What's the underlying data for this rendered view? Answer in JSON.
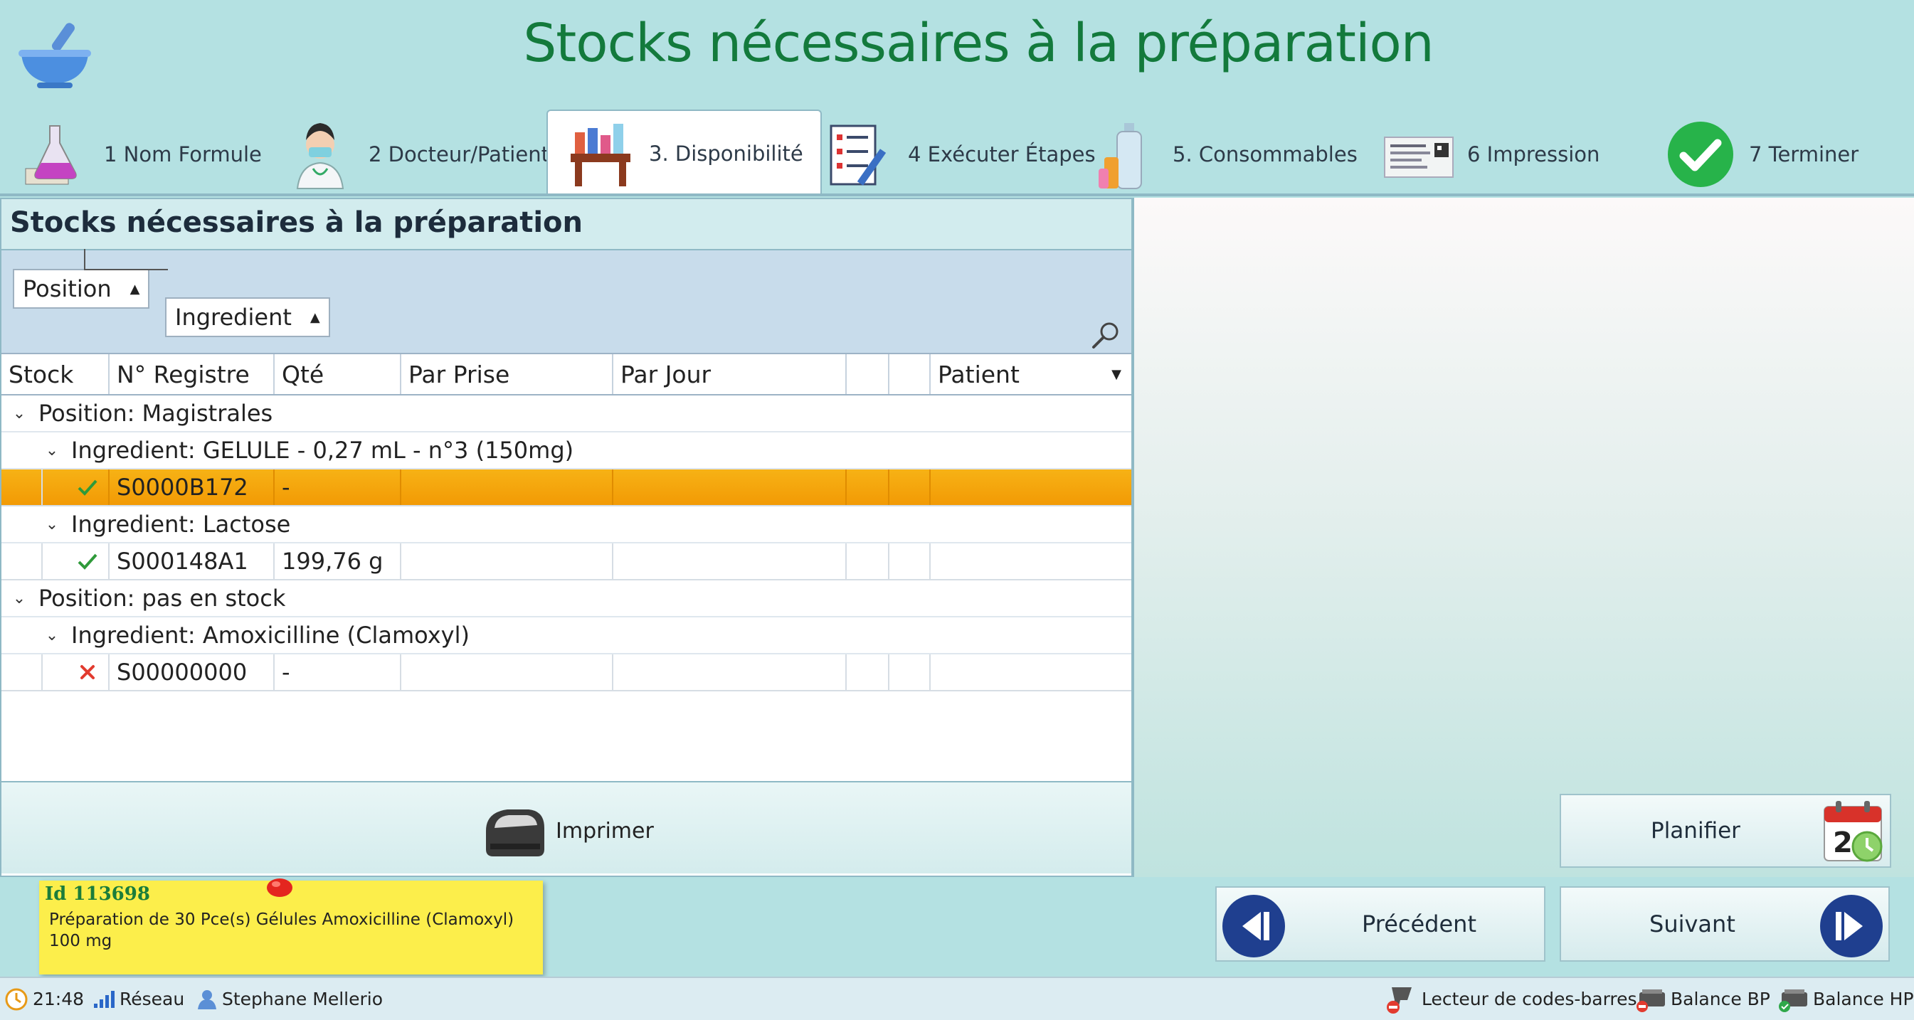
{
  "title": "Stocks nécessaires à la préparation",
  "tabs": [
    {
      "label": "1  Nom Formule"
    },
    {
      "label": "2  Docteur/Patient"
    },
    {
      "label": "3.  Disponibilité"
    },
    {
      "label": "4  Exécuter Étapes"
    },
    {
      "label": "5.  Consommables"
    },
    {
      "label": "6  Impression"
    },
    {
      "label": "7  Terminer"
    }
  ],
  "panel": {
    "title": "Stocks nécessaires à la préparation",
    "group_chips": [
      "Position",
      "Ingredient"
    ],
    "columns": [
      "Stock",
      "N° Registre",
      "Qté",
      "Par Prise",
      "Par Jour",
      "",
      "",
      "Patient"
    ],
    "groups": [
      {
        "label": "Position: Magistrales",
        "ingredients": [
          {
            "label": "Ingredient: GELULE - 0,27 mL - n°3 (150mg)",
            "row": {
              "status": "ok",
              "registre": "S0000B172",
              "qte": "-"
            }
          },
          {
            "label": "Ingredient: Lactose",
            "row": {
              "status": "ok",
              "registre": "S000148A1",
              "qte": "199,76 g"
            }
          }
        ]
      },
      {
        "label": "Position: pas en stock",
        "ingredients": [
          {
            "label": "Ingredient: Amoxicilline (Clamoxyl)",
            "row": {
              "status": "missing",
              "registre": "S00000000",
              "qte": "-"
            }
          }
        ]
      }
    ],
    "print_label": "Imprimer"
  },
  "plan_label": "Planifier",
  "note": {
    "id": "Id 113698",
    "text": "Préparation de 30 Pce(s) Gélules Amoxicilline (Clamoxyl) 100 mg"
  },
  "nav": {
    "prev": "Précédent",
    "next": "Suivant"
  },
  "status": {
    "time": "21:48",
    "network": "Réseau",
    "user": "Stephane Mellerio",
    "barcode": "Lecteur de codes-barres",
    "balance_bp": "Balance BP",
    "balance_hp": "Balance HP"
  },
  "colors": {
    "background": "#b4e1e2",
    "title": "#137a3c",
    "selected_row": "#f4a60b",
    "note": "#fcee4b",
    "nav_circle": "#1f3f8f"
  }
}
